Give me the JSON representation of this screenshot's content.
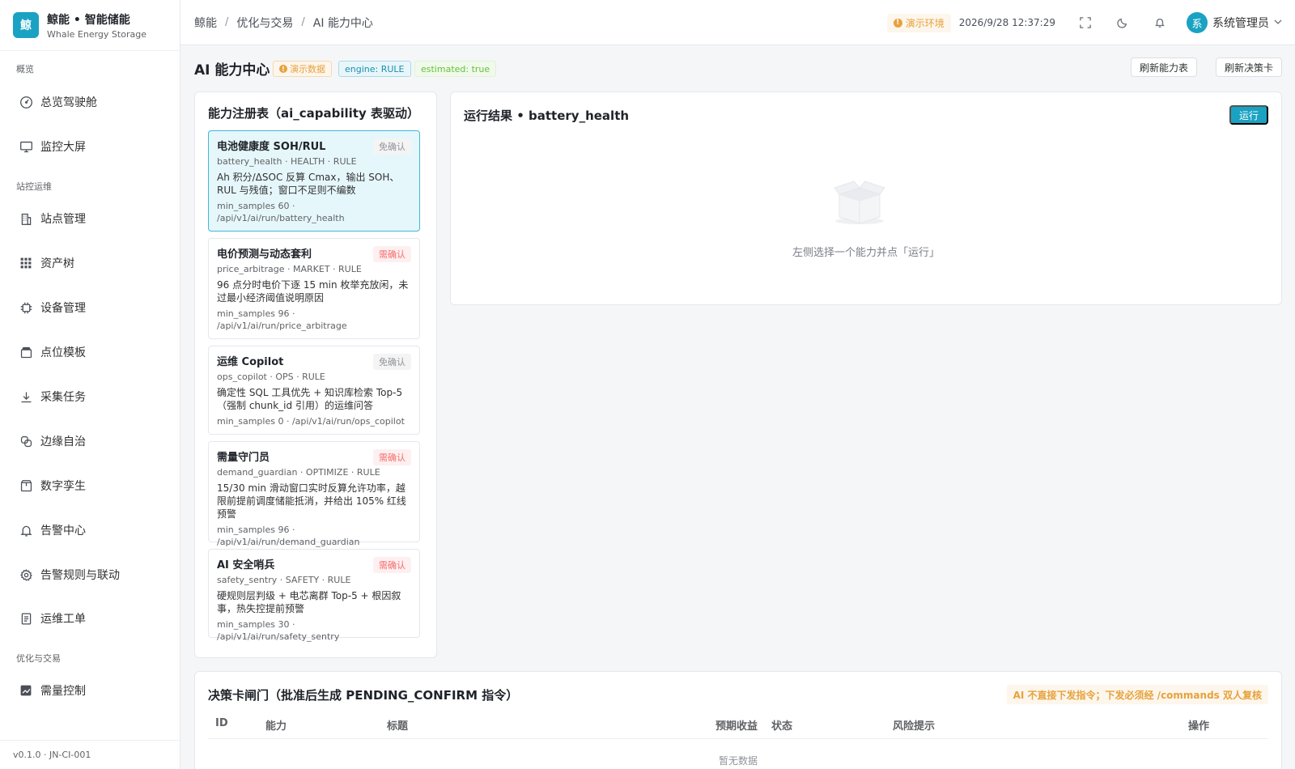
{
  "brand": {
    "logo_char": "鲸",
    "title": "鲸能 • 智能储能",
    "subtitle": "Whale Energy Storage"
  },
  "sidebar": {
    "groups": [
      "概览",
      "站控运维",
      "优化与交易"
    ],
    "items": [
      {
        "label": "总览驾驶舱",
        "icon": "gauge-icon"
      },
      {
        "label": "监控大屏",
        "icon": "monitor-icon"
      },
      {
        "label": "站点管理",
        "icon": "building-icon"
      },
      {
        "label": "资产树",
        "icon": "grid-icon"
      },
      {
        "label": "设备管理",
        "icon": "chip-icon"
      },
      {
        "label": "点位模板",
        "icon": "template-icon"
      },
      {
        "label": "采集任务",
        "icon": "download-icon"
      },
      {
        "label": "边缘自治",
        "icon": "link-icon"
      },
      {
        "label": "数字孪生",
        "icon": "box-icon"
      },
      {
        "label": "告警中心",
        "icon": "bell-icon"
      },
      {
        "label": "告警规则与联动",
        "icon": "gear-icon"
      },
      {
        "label": "运维工单",
        "icon": "document-icon"
      },
      {
        "label": "需量控制",
        "icon": "chart-icon"
      }
    ],
    "footer": "v0.1.0 · JN-CI-001"
  },
  "header": {
    "breadcrumb": [
      "鲸能",
      "优化与交易",
      "AI 能力中心"
    ],
    "env_tag": "演示环境",
    "datetime": "2026/9/28 12:37:29",
    "user_avatar": "系",
    "user_name": "系统管理员"
  },
  "page": {
    "title": "AI 能力中心",
    "tags": [
      "演示数据",
      "engine: RULE",
      "estimated: true"
    ],
    "buttons": [
      "刷新能力表",
      "刷新决策卡"
    ]
  },
  "capabilities": {
    "title": "能力注册表（ai_capability 表驱动）",
    "items": [
      {
        "name": "电池健康度 SOH/RUL",
        "confirm": "免确认",
        "meta": "battery_health · HEALTH · RULE",
        "desc": "Ah 积分/ΔSOC 反算 Cmax，输出 SOH、RUL 与残值；窗口不足则不编数",
        "foot": "min_samples 60 · /api/v1/ai/run/battery_health"
      },
      {
        "name": "电价预测与动态套利",
        "confirm": "需确认",
        "meta": "price_arbitrage · MARKET · RULE",
        "desc": "96 点分时电价下逐 15 min 枚举充放闲，未过最小经济阈值说明原因",
        "foot": "min_samples 96 · /api/v1/ai/run/price_arbitrage"
      },
      {
        "name": "运维 Copilot",
        "confirm": "免确认",
        "meta": "ops_copilot · OPS · RULE",
        "desc": "确定性 SQL 工具优先 + 知识库检索 Top-5（强制 chunk_id 引用）的运维问答",
        "foot": "min_samples 0 · /api/v1/ai/run/ops_copilot"
      },
      {
        "name": "需量守门员",
        "confirm": "需确认",
        "meta": "demand_guardian · OPTIMIZE · RULE",
        "desc": "15/30 min 滑动窗口实时反算允许功率，越限前提前调度储能抵消，并给出 105% 红线预警",
        "foot": "min_samples 96 · /api/v1/ai/run/demand_guardian"
      },
      {
        "name": "AI 安全哨兵",
        "confirm": "需确认",
        "meta": "safety_sentry · SAFETY · RULE",
        "desc": "硬规则层判级 + 电芯离群 Top-5 + 根因叙事，热失控提前预警",
        "foot": "min_samples 30 · /api/v1/ai/run/safety_sentry"
      }
    ]
  },
  "result": {
    "title": "运行结果 • battery_health",
    "run_label": "运行",
    "empty_text": "左侧选择一个能力并点「运行」"
  },
  "decision": {
    "title": "决策卡闸门（批准后生成 PENDING_CONFIRM 指令）",
    "warning": "AI 不直接下发指令；下发必须经 /commands 双人复核",
    "columns": [
      "ID",
      "能力",
      "标题",
      "预期收益",
      "状态",
      "风险提示",
      "操作"
    ],
    "empty": "暂无数据"
  },
  "colors": {
    "accent": "#1aa2c3",
    "warning": "#e6a23c",
    "danger": "#f56c6c",
    "success": "#67c23a"
  }
}
